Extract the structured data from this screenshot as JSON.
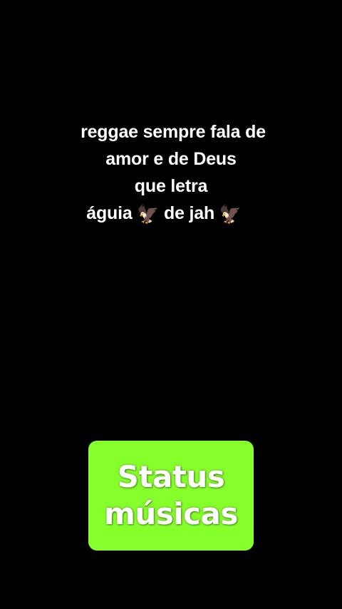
{
  "colors": {
    "background": "#000000",
    "caption_text": "#ffffff",
    "badge_background": "#86ff2b",
    "badge_text": "#ffffff"
  },
  "caption": {
    "line1": "reggae sempre fala de",
    "line2": "amor e de Deus",
    "line3": "que letra",
    "line4_part1": "águia",
    "line4_part2": "de jah",
    "eagle_emoji": "🦅"
  },
  "badge": {
    "line1": "Status",
    "line2": "músicas"
  }
}
